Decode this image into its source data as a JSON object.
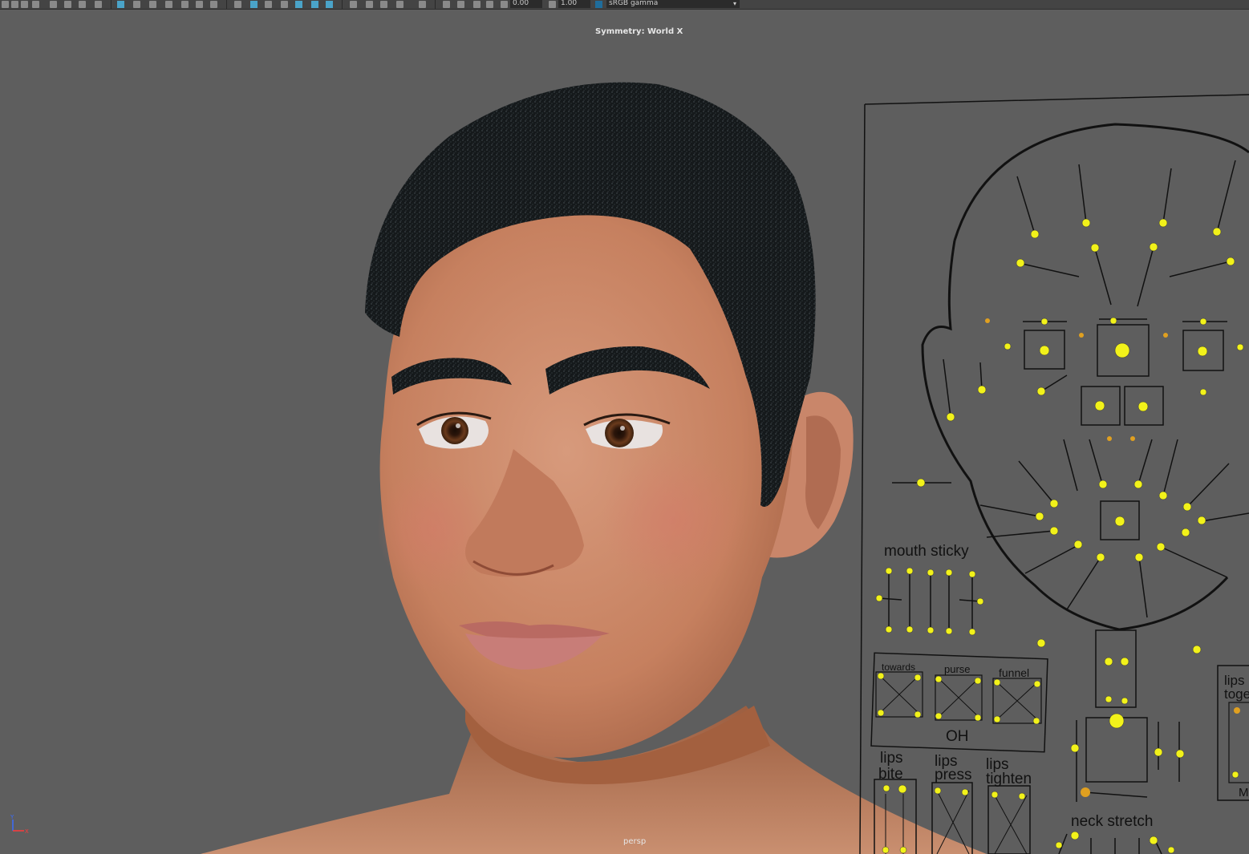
{
  "toolbar": {
    "exposure_value": "0.00",
    "gamma_value": "1.00",
    "color_space": "sRGB gamma",
    "icons": [
      "select-tool-icon",
      "lasso-icon",
      "paint-select-icon",
      "camera-icon",
      "bookmark-icon",
      "move-icon",
      "rotate-icon",
      "scale-icon",
      "grid-icon",
      "wireframe-icon",
      "smooth-shade-icon",
      "textured-icon",
      "lights-icon",
      "shadows-icon",
      "isolate-icon",
      "xray-icon",
      "hud-icon",
      "resolution-gate-icon",
      "gate-mask-icon",
      "film-gate-icon",
      "exposure-icon",
      "gamma-icon",
      "color-management-icon"
    ]
  },
  "viewport": {
    "symmetry_label": "Symmetry: World X",
    "camera_label": "persp",
    "background_color": "#5e5e5e"
  },
  "face_rig": {
    "labels": {
      "mouth_sticky": "mouth sticky",
      "towards": "towards",
      "purse": "purse",
      "funnel": "funnel",
      "oh": "OH",
      "lips_bite": [
        "lips",
        "bite"
      ],
      "lips_press": [
        "lips",
        "press"
      ],
      "lips_tighten": [
        "lips",
        "tighten"
      ],
      "lips_together": [
        "lips",
        "toge"
      ],
      "neck_stretch": "neck stretch",
      "partial_m": "M"
    },
    "control_color": "#f2f21a",
    "secondary_control_color": "#e0a020",
    "line_color": "#111111"
  },
  "axis": {
    "y_label": "Y",
    "x_label": "X"
  }
}
